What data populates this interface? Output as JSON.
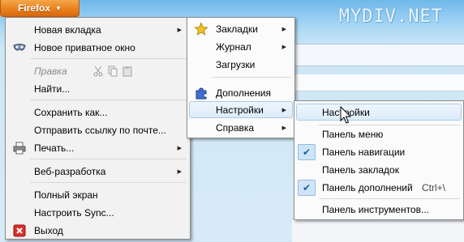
{
  "watermark": "MYDIV.NET",
  "app_button": {
    "label": "Firefox"
  },
  "main_menu": {
    "items": [
      {
        "label": "Новая вкладка",
        "submenu": true
      },
      {
        "label": "Новое приватное окно",
        "icon": "mask-icon"
      },
      {
        "label": "Правка",
        "disabled": true
      },
      {
        "label": "Найти..."
      },
      {
        "label": "Сохранить как..."
      },
      {
        "label": "Отправить ссылку по почте..."
      },
      {
        "label": "Печать...",
        "submenu": true,
        "icon": "printer-icon"
      },
      {
        "label": "Веб-разработка",
        "submenu": true
      },
      {
        "label": "Полный экран"
      },
      {
        "label": "Настроить Sync..."
      },
      {
        "label": "Выход",
        "icon": "exit-icon"
      }
    ]
  },
  "side_menu": {
    "items": [
      {
        "label": "Закладки",
        "submenu": true,
        "icon": "star-icon"
      },
      {
        "label": "Журнал",
        "submenu": true
      },
      {
        "label": "Загрузки"
      },
      {
        "label": "Дополнения",
        "icon": "puzzle-icon"
      },
      {
        "label": "Настройки",
        "submenu": true,
        "highlighted": true
      },
      {
        "label": "Справка",
        "submenu": true
      }
    ]
  },
  "settings_menu": {
    "items": [
      {
        "label": "Настройки",
        "highlighted": true
      },
      {
        "label": "Панель меню",
        "checked": false
      },
      {
        "label": "Панель навигации",
        "checked": true
      },
      {
        "label": "Панель закладок",
        "checked": false
      },
      {
        "label": "Панель дополнений",
        "checked": true,
        "shortcut": "Ctrl+\\"
      },
      {
        "label": "Панель инструментов..."
      }
    ]
  },
  "colors": {
    "accent": "#e8811e",
    "highlight": "#dcebfa",
    "check": "#1a5ea8"
  }
}
